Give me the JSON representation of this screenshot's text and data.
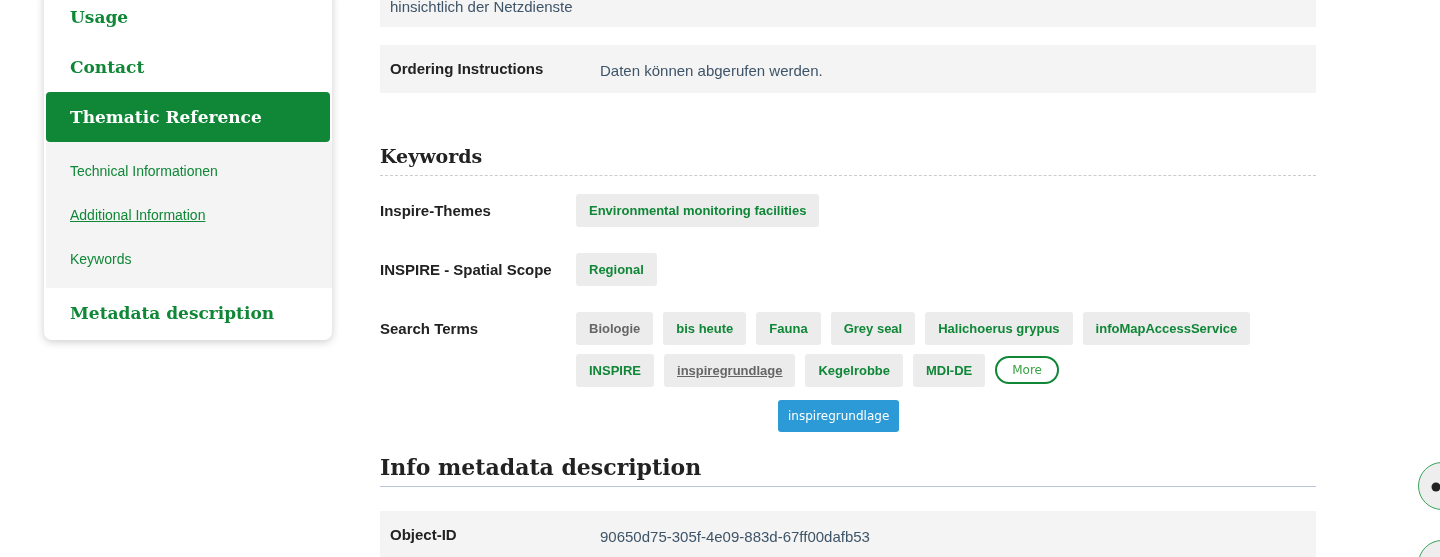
{
  "sidebar": {
    "items": [
      {
        "label": "Usage",
        "selected": false
      },
      {
        "label": "Contact",
        "selected": false
      },
      {
        "label": "Thematic Reference",
        "selected": true,
        "children": [
          {
            "label": "Technical Informationen",
            "hovered": false
          },
          {
            "label": "Additional Information",
            "hovered": true
          },
          {
            "label": "Keywords",
            "hovered": false
          }
        ]
      },
      {
        "label": "Metadata description",
        "selected": false
      }
    ]
  },
  "top_rows": [
    {
      "label": "",
      "value": "hinsichtlich der Netzdienste"
    },
    {
      "label": "Ordering Instructions",
      "value": "Daten können abgerufen werden."
    }
  ],
  "keywords": {
    "title": "Keywords",
    "groups": [
      {
        "label": "Inspire-Themes",
        "tags": [
          {
            "text": "Environmental monitoring facilities",
            "visited": false,
            "hovered": false
          }
        ]
      },
      {
        "label": "INSPIRE - Spatial Scope",
        "tags": [
          {
            "text": "Regional",
            "visited": false,
            "hovered": false
          }
        ]
      },
      {
        "label": "Search Terms",
        "tags": [
          {
            "text": "Biologie",
            "visited": true,
            "hovered": false
          },
          {
            "text": "bis heute",
            "visited": false,
            "hovered": false
          },
          {
            "text": "Fauna",
            "visited": false,
            "hovered": false
          },
          {
            "text": "Grey seal",
            "visited": false,
            "hovered": false
          },
          {
            "text": "Halichoerus grypus",
            "visited": false,
            "hovered": false
          },
          {
            "text": "infoMapAccessService",
            "visited": false,
            "hovered": false
          },
          {
            "text": "INSPIRE",
            "visited": false,
            "hovered": false
          },
          {
            "text": "inspiregrundlage",
            "visited": true,
            "hovered": true
          },
          {
            "text": "Kegelrobbe",
            "visited": false,
            "hovered": false
          },
          {
            "text": "MDI-DE",
            "visited": false,
            "hovered": false
          }
        ],
        "more": "More",
        "tooltip": "inspiregrundlage"
      }
    ]
  },
  "info": {
    "title": "Info metadata description",
    "rows": [
      {
        "label": "Object-ID",
        "value": "90650d75-305f-4e09-883d-67ff00dafb53"
      }
    ]
  }
}
